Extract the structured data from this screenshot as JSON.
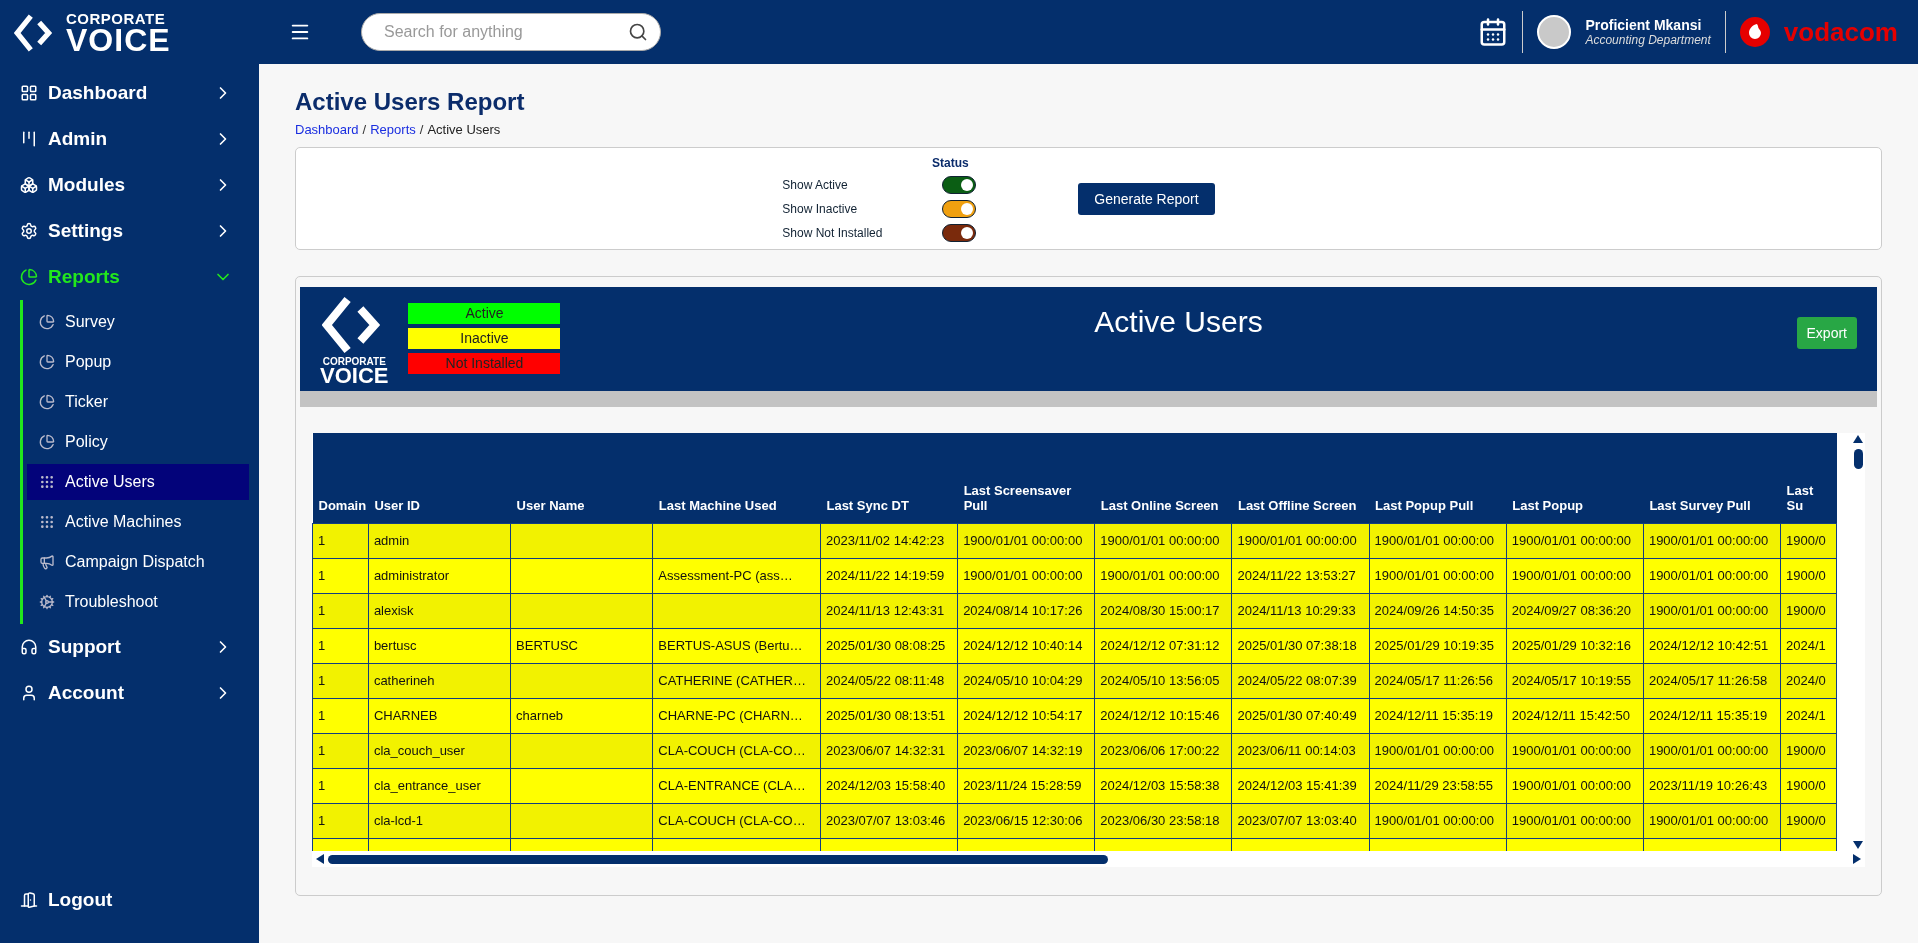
{
  "brand": {
    "top": "CORPORATE",
    "bottom": "VOICE"
  },
  "nav": [
    {
      "label": "Dashboard",
      "expanded": false
    },
    {
      "label": "Admin",
      "expanded": false
    },
    {
      "label": "Modules",
      "expanded": false
    },
    {
      "label": "Settings",
      "expanded": false
    },
    {
      "label": "Reports",
      "expanded": true,
      "children": [
        {
          "label": "Survey",
          "selected": false
        },
        {
          "label": "Popup",
          "selected": false
        },
        {
          "label": "Ticker",
          "selected": false
        },
        {
          "label": "Policy",
          "selected": false
        },
        {
          "label": "Active Users",
          "selected": true
        },
        {
          "label": "Active Machines",
          "selected": false
        },
        {
          "label": "Campaign Dispatch",
          "selected": false
        },
        {
          "label": "Troubleshoot",
          "selected": false
        }
      ]
    },
    {
      "label": "Support",
      "expanded": false
    },
    {
      "label": "Account",
      "expanded": false
    }
  ],
  "logout": "Logout",
  "search": {
    "placeholder": "Search for anything"
  },
  "user": {
    "name": "Proficient Mkansi",
    "department": "Accounting Department"
  },
  "operator": "vodacom",
  "page": {
    "title": "Active Users Report",
    "separator": "/",
    "breadcrumbs": [
      {
        "label": "Dashboard",
        "kind": "link"
      },
      {
        "label": "Reports",
        "kind": "link"
      },
      {
        "label": "Active Users",
        "kind": "current"
      }
    ]
  },
  "filters": {
    "title": "Status",
    "toggles": [
      {
        "label": "Show Active",
        "on": true,
        "color": "#0b5e14"
      },
      {
        "label": "Show Inactive",
        "on": true,
        "color": "#f0a010"
      },
      {
        "label": "Show Not Installed",
        "on": true,
        "color": "#7a2a0c"
      }
    ],
    "button": "Generate Report"
  },
  "report": {
    "logo": {
      "top": "CORPORATE",
      "bottom": "VOICE"
    },
    "legend": [
      {
        "label": "Active",
        "color": "#00ff00"
      },
      {
        "label": "Inactive",
        "color": "#ffff00"
      },
      {
        "label": "Not Installed",
        "color": "#ff0000"
      }
    ],
    "title": "Active Users",
    "export": "Export"
  },
  "table": {
    "columns": [
      "Domain",
      "User ID",
      "User Name",
      "Last Machine Used",
      "Last Sync DT",
      "Last Screensaver Pull",
      "Last Online Screen",
      "Last Offline Screen",
      "Last Popup Pull",
      "Last Popup",
      "Last Survey Pull",
      "Last Su"
    ],
    "rows": [
      [
        "1",
        "admin",
        "",
        "",
        "2023/11/02 14:42:23",
        "1900/01/01 00:00:00",
        "1900/01/01 00:00:00",
        "1900/01/01 00:00:00",
        "1900/01/01 00:00:00",
        "1900/01/01 00:00:00",
        "1900/01/01 00:00:00",
        "1900/0"
      ],
      [
        "1",
        "administrator",
        "",
        "Assessment-PC (ass…",
        "2024/11/22 14:19:59",
        "1900/01/01 00:00:00",
        "1900/01/01 00:00:00",
        "2024/11/22 13:53:27",
        "1900/01/01 00:00:00",
        "1900/01/01 00:00:00",
        "1900/01/01 00:00:00",
        "1900/0"
      ],
      [
        "1",
        "alexisk",
        "",
        "",
        "2024/11/13 12:43:31",
        "2024/08/14 10:17:26",
        "2024/08/30 15:00:17",
        "2024/11/13 10:29:33",
        "2024/09/26 14:50:35",
        "2024/09/27 08:36:20",
        "1900/01/01 00:00:00",
        "1900/0"
      ],
      [
        "1",
        "bertusc",
        "BERTUSC",
        "BERTUS-ASUS (Bertu…",
        "2025/01/30 08:08:25",
        "2024/12/12 10:40:14",
        "2024/12/12 07:31:12",
        "2025/01/30 07:38:18",
        "2025/01/29 10:19:35",
        "2025/01/29 10:32:16",
        "2024/12/12 10:42:51",
        "2024/1"
      ],
      [
        "1",
        "catherineh",
        "",
        "CATHERINE (CATHER…",
        "2024/05/22 08:11:48",
        "2024/05/10 10:04:29",
        "2024/05/10 13:56:05",
        "2024/05/22 08:07:39",
        "2024/05/17 11:26:56",
        "2024/05/17 10:19:55",
        "2024/05/17 11:26:58",
        "2024/0"
      ],
      [
        "1",
        "CHARNEB",
        "charneb",
        "CHARNE-PC (CHARN…",
        "2025/01/30 08:13:51",
        "2024/12/12 10:54:17",
        "2024/12/12 10:15:46",
        "2025/01/30 07:40:49",
        "2024/12/11 15:35:19",
        "2024/12/11 15:42:50",
        "2024/12/11 15:35:19",
        "2024/1"
      ],
      [
        "1",
        "cla_couch_user",
        "",
        "CLA-COUCH (CLA-CO…",
        "2023/06/07 14:32:31",
        "2023/06/07 14:32:19",
        "2023/06/06 17:00:22",
        "2023/06/11 00:14:03",
        "1900/01/01 00:00:00",
        "1900/01/01 00:00:00",
        "1900/01/01 00:00:00",
        "1900/0"
      ],
      [
        "1",
        "cla_entrance_user",
        "",
        "CLA-ENTRANCE (CLA…",
        "2024/12/03 15:58:40",
        "2023/11/24 15:28:59",
        "2024/12/03 15:58:38",
        "2024/12/03 15:41:39",
        "2024/11/29 23:58:55",
        "1900/01/01 00:00:00",
        "2023/11/19 10:26:43",
        "1900/0"
      ],
      [
        "1",
        "cla-lcd-1",
        "",
        "CLA-COUCH (CLA-CO…",
        "2023/07/07 13:03:46",
        "2023/06/15 12:30:06",
        "2023/06/30 23:58:18",
        "2023/07/07 13:03:40",
        "1900/01/01 00:00:00",
        "1900/01/01 00:00:00",
        "1900/01/01 00:00:00",
        "1900/0"
      ]
    ]
  }
}
